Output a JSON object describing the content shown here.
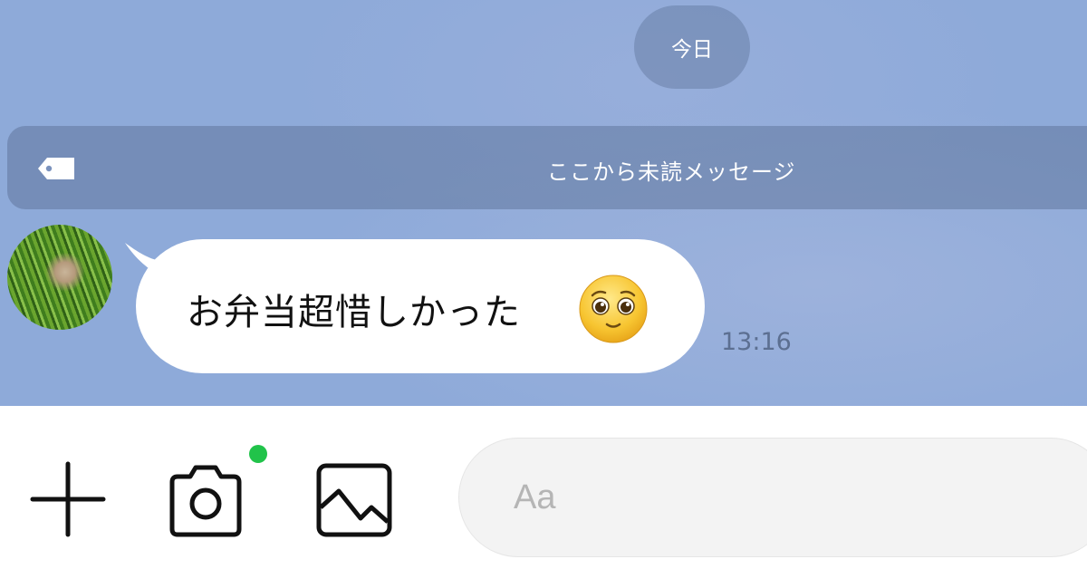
{
  "chat": {
    "date_separator": "今日",
    "unread_marker": "ここから未読メッセージ",
    "messages": [
      {
        "sender": "other",
        "text": "お弁当超惜しかった",
        "emoji": "pleading-face-emoji",
        "time": "13:16"
      }
    ]
  },
  "composer": {
    "icons": [
      "plus-icon",
      "camera-icon",
      "image-icon"
    ],
    "camera_notification_color": "#21c34a",
    "placeholder": "Aa",
    "value": ""
  },
  "colors": {
    "chat_background": "#8eaad9",
    "bubble": "#ffffff",
    "timestamp": "#5c6f91"
  }
}
